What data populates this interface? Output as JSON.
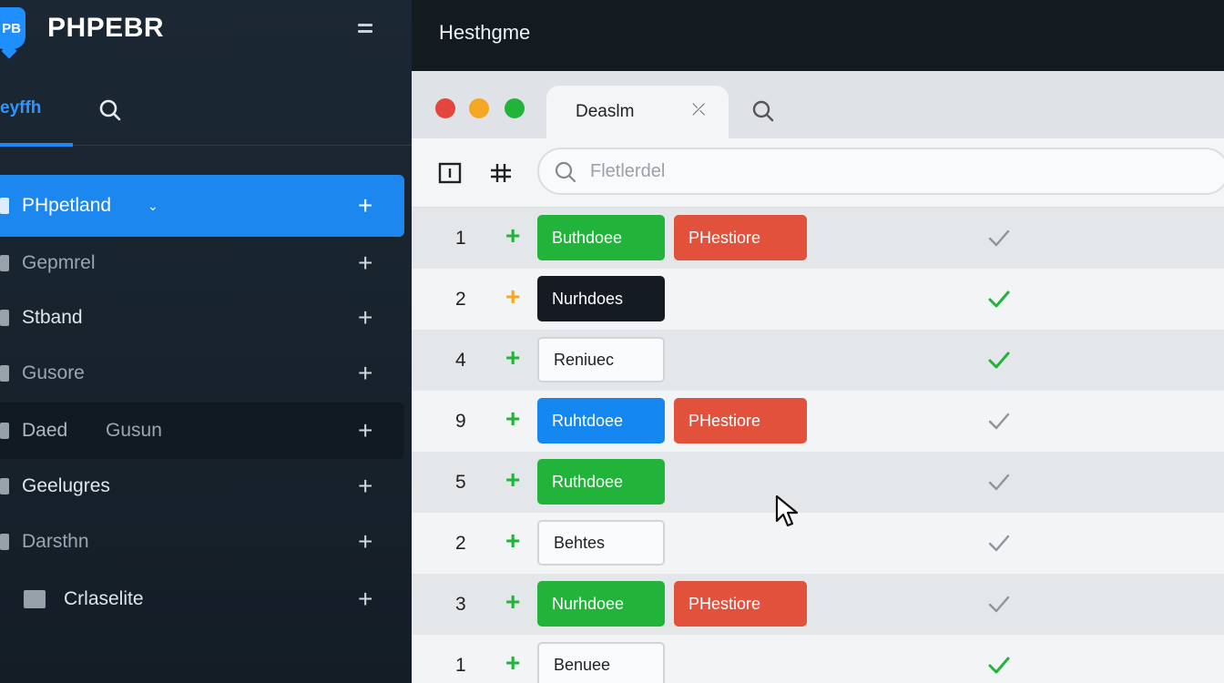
{
  "brand": {
    "logo_text": "PB",
    "name": "PHPEBR"
  },
  "sidebar": {
    "active_tab": "eyffh",
    "items": [
      {
        "label": "PHpetland",
        "style": "active",
        "caret": "⌄"
      },
      {
        "label": "Gepmrel",
        "style": "muted"
      },
      {
        "label": "Stband",
        "style": "normal"
      },
      {
        "label": "Gusore",
        "style": "muted"
      },
      {
        "label": "Daed",
        "second": "Gusun",
        "style": "dark"
      },
      {
        "label": "Geelugres",
        "style": "normal"
      },
      {
        "label": "Darsthn",
        "style": "muted"
      },
      {
        "label": "Crlaselite",
        "style": "normal"
      }
    ]
  },
  "topbar": {
    "title": "Hesthgme"
  },
  "window": {
    "traffic_lights": [
      "#e5463c",
      "#f5a623",
      "#22b33b"
    ],
    "tab_label": "Deaslm",
    "search_placeholder": "Fletlerdel"
  },
  "rows": [
    {
      "num": "1",
      "plus_color": "#22b33b",
      "pill1": {
        "label": "Buthdoee",
        "style": "green"
      },
      "pill2": {
        "label": "PHestiore",
        "style": "red"
      },
      "check": "gray"
    },
    {
      "num": "2",
      "plus_color": "#f5a623",
      "pill1": {
        "label": "Nurhdoes",
        "style": "black"
      },
      "pill2": null,
      "check": "green"
    },
    {
      "num": "4",
      "plus_color": "#22b33b",
      "pill1": {
        "label": "Reniuec",
        "style": "white"
      },
      "pill2": null,
      "check": "green"
    },
    {
      "num": "9",
      "plus_color": "#22b33b",
      "pill1": {
        "label": "Ruhtdoee",
        "style": "blue"
      },
      "pill2": {
        "label": "PHestiore",
        "style": "red"
      },
      "check": "gray"
    },
    {
      "num": "5",
      "plus_color": "#22b33b",
      "pill1": {
        "label": "Ruthdoee",
        "style": "green"
      },
      "pill2": null,
      "check": "gray"
    },
    {
      "num": "2",
      "plus_color": "#22b33b",
      "pill1": {
        "label": "Behtes",
        "style": "white"
      },
      "pill2": null,
      "check": "gray"
    },
    {
      "num": "3",
      "plus_color": "#22b33b",
      "pill1": {
        "label": "Nurhdoee",
        "style": "green"
      },
      "pill2": {
        "label": "PHestiore",
        "style": "red"
      },
      "check": "gray"
    },
    {
      "num": "1",
      "plus_color": "#22b33b",
      "pill1": {
        "label": "Benuee",
        "style": "white"
      },
      "pill2": null,
      "check": "green"
    }
  ],
  "colors": {
    "check_green": "#22b33b",
    "check_gray": "#8d959c",
    "accent": "#1d87f0"
  }
}
